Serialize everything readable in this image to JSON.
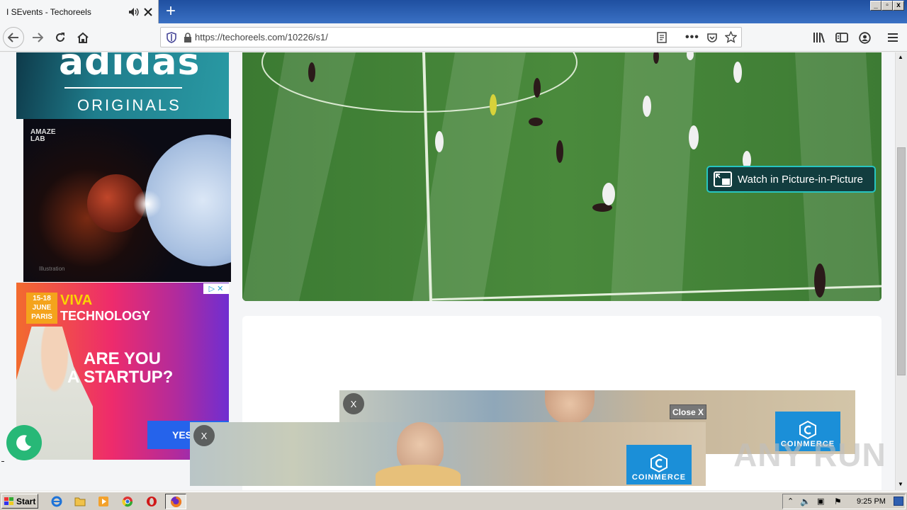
{
  "browser": {
    "tab": {
      "title": "I SEvents - Techoreels"
    },
    "new_tab": "+",
    "window_controls": [
      "_",
      "▫",
      "x"
    ],
    "url": "https://techoreels.com/10226/s1/"
  },
  "video": {
    "pip_label": "Watch in Picture-in-Picture"
  },
  "ads": {
    "adidas": {
      "brand": "adidas",
      "tagline": "ORIGINALS"
    },
    "amaze": {
      "brand": "AMAZE LAB",
      "caption": "Illustration"
    },
    "viva": {
      "date_line1": "15-18",
      "date_line2": "JUNE",
      "city": "PARIS",
      "brand": "VIVA",
      "brand2": "TECHNOLOGY",
      "headline1": "ARE YOU",
      "headline2": "A STARTUP?",
      "cta": "YES"
    },
    "coinmerce_top": {
      "close_label": "X",
      "close_button": "Close X",
      "brand": "COINMERCE"
    },
    "coinmerce_bottom": {
      "close_label": "X",
      "brand": "COINMERCE"
    }
  },
  "watermark": "ANY RUN",
  "taskbar": {
    "start_label": "Start",
    "clock": "9:25 PM"
  }
}
